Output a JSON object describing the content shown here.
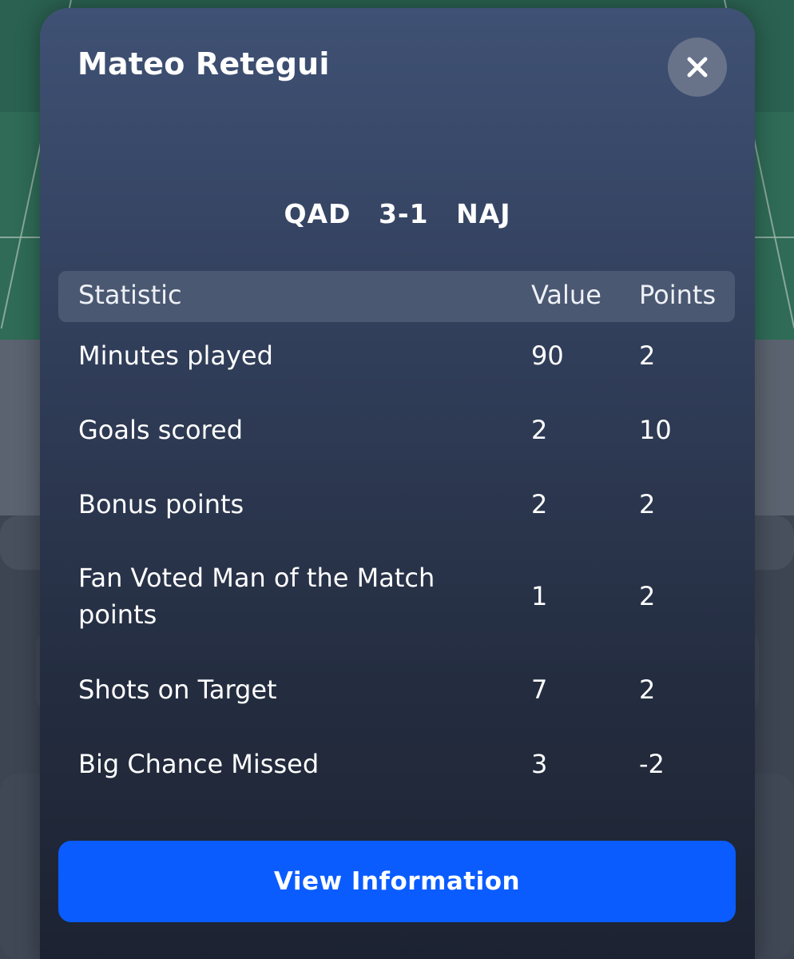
{
  "modal": {
    "title": "Mateo Retegui",
    "close_label": "close",
    "match": {
      "home": "QAD",
      "score": "3-1",
      "away": "NAJ"
    },
    "table": {
      "headers": {
        "statistic": "Statistic",
        "value": "Value",
        "points": "Points"
      },
      "rows": [
        {
          "statistic": "Minutes played",
          "value": "90",
          "points": "2"
        },
        {
          "statistic": "Goals scored",
          "value": "2",
          "points": "10"
        },
        {
          "statistic": "Bonus points",
          "value": "2",
          "points": "2"
        },
        {
          "statistic": "Fan Voted Man of the Match points",
          "value": "1",
          "points": "2"
        },
        {
          "statistic": "Shots on Target",
          "value": "7",
          "points": "2"
        },
        {
          "statistic": "Big Chance Missed",
          "value": "3",
          "points": "-2"
        }
      ]
    },
    "view_button_label": "View Information"
  },
  "icons": {
    "close": "close-icon"
  },
  "colors": {
    "primary_button": "#0a5cff",
    "pitch": "#2f6b57"
  }
}
